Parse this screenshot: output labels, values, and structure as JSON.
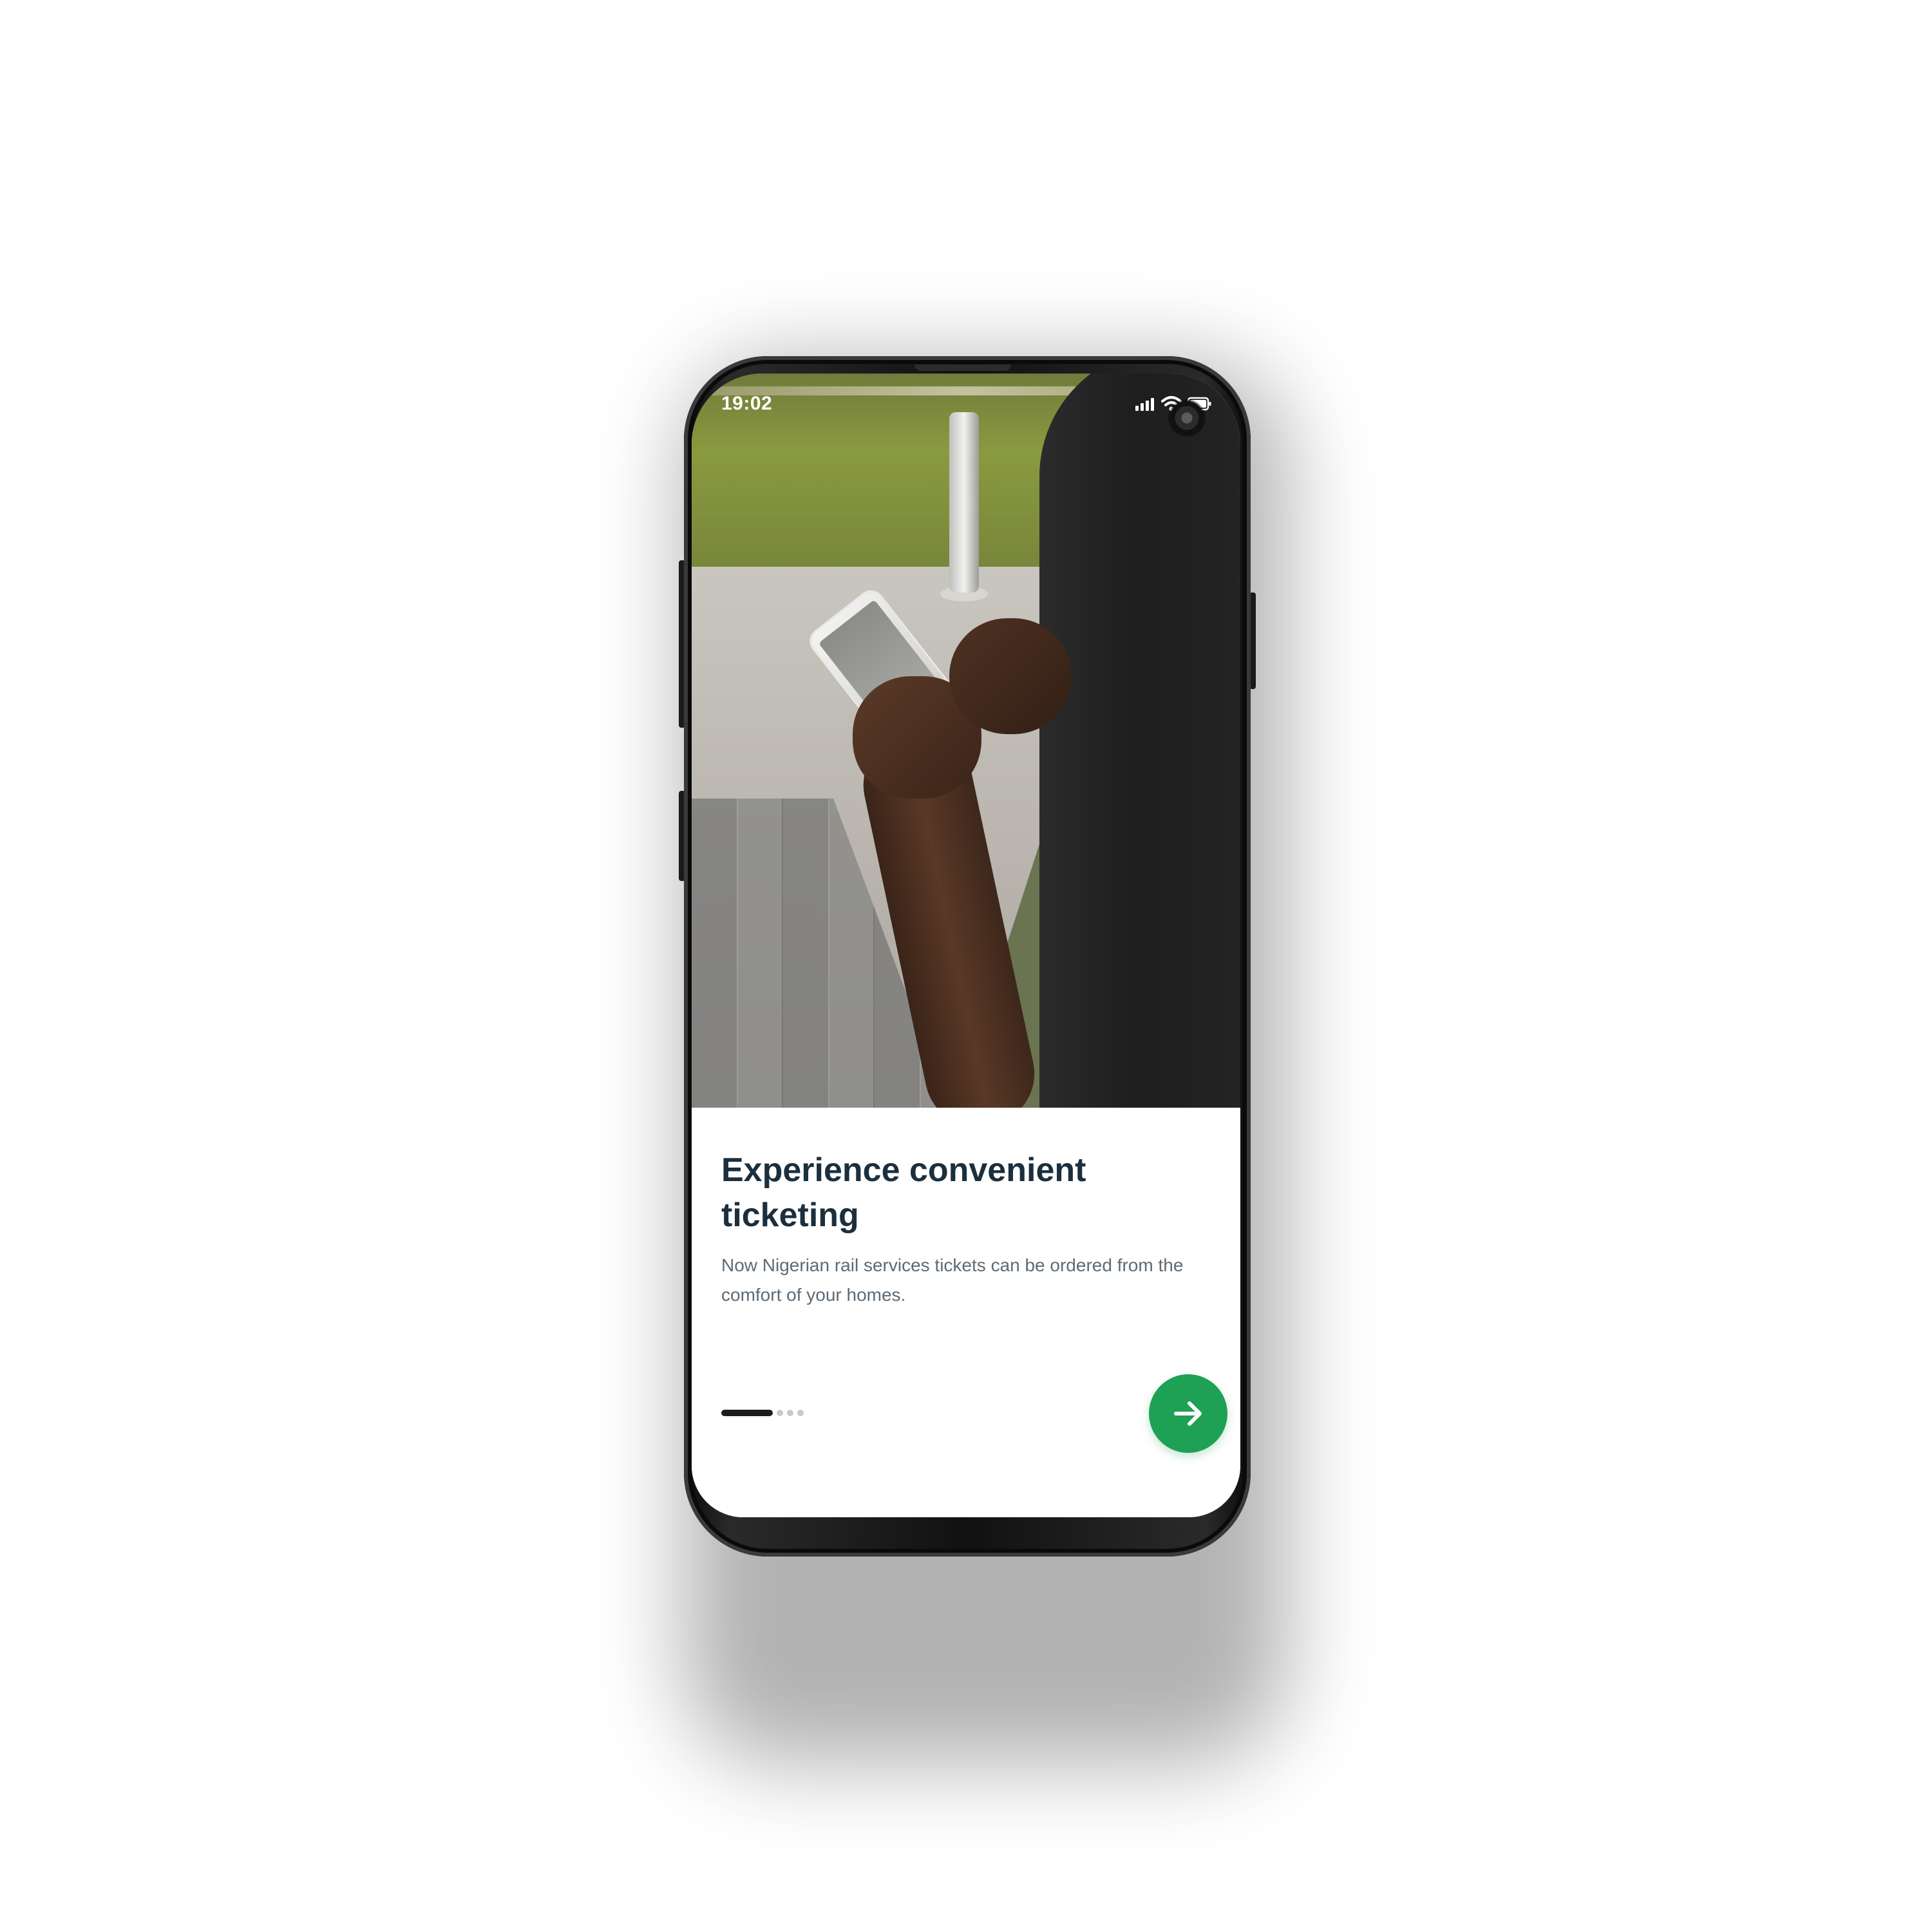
{
  "status_bar": {
    "time": "19:02"
  },
  "onboarding": {
    "title": "Experience convenient ticketing",
    "description": "Now Nigerian rail services tickets can be ordered from the comfort of your homes.",
    "current_page": 1,
    "total_pages": 4,
    "next_icon": "arrow-right-icon"
  },
  "colors": {
    "accent": "#1ea055",
    "title": "#1b2f3e",
    "body_text": "#5d6b76",
    "pager_active": "#1c1c1c",
    "pager_inactive": "#c9c9c9"
  }
}
